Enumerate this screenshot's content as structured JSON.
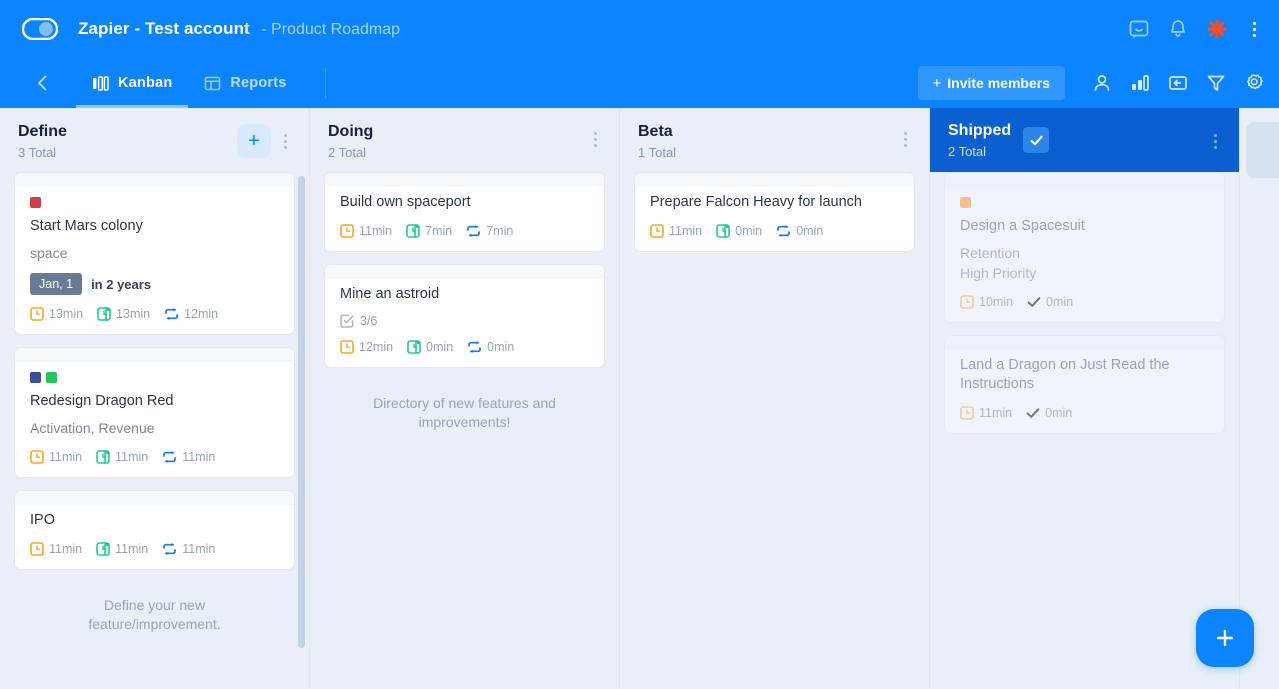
{
  "topbar": {
    "logo_icon": "zapier-toggle-logo",
    "title": "Zapier - Test account",
    "subtitle": "- Product Roadmap",
    "icons": [
      {
        "name": "feedback-icon",
        "label": "Feedback"
      },
      {
        "name": "bell-icon",
        "label": "Notifications"
      },
      {
        "name": "zapier-logo-icon",
        "label": "Zapier"
      },
      {
        "name": "overflow-menu-icon",
        "label": "More"
      }
    ]
  },
  "subbar": {
    "back_icon": "chevron-left-icon",
    "tabs": [
      {
        "label": "Kanban",
        "icon": "kanban-board-icon",
        "active": true
      },
      {
        "label": "Reports",
        "icon": "reports-table-icon",
        "active": false
      }
    ],
    "invite_label": "Invite members",
    "invite_plus": "+",
    "actions": [
      {
        "name": "person-icon",
        "label": "Members"
      },
      {
        "name": "bar-chart-icon",
        "label": "Stats"
      },
      {
        "name": "archive-time-icon",
        "label": "Archive"
      },
      {
        "name": "filter-icon",
        "label": "Filter"
      },
      {
        "name": "gear-icon",
        "label": "Settings"
      }
    ]
  },
  "colors": {
    "brand_blue": "#0b84fe",
    "shipped_header": "#0b5fd0",
    "board_bg": "#eaeef7",
    "label_red": "#c8414b",
    "label_navy": "#3b4d9e",
    "label_green": "#22c55e",
    "label_orange": "#f7b06a",
    "metric_orange": "#f5a623",
    "metric_green": "#20c997",
    "metric_blue": "#1479f5"
  },
  "columns": [
    {
      "name": "Define",
      "count": "3 Total",
      "has_add_button": true,
      "add_label": "+",
      "state": "normal",
      "hint": "Define your new feature/improvement.",
      "has_scrollbar": true,
      "cards": [
        {
          "title": "Start Mars colony",
          "subtitle": "space",
          "labels": [
            "#c8414b"
          ],
          "date_badge": "Jan, 1",
          "date_relative": "in 2 years",
          "metrics": [
            {
              "icon": "clock-orange-icon",
              "value": "13min"
            },
            {
              "icon": "clock-green-icon",
              "value": "13min"
            },
            {
              "icon": "repeat-blue-icon",
              "value": "12min"
            }
          ]
        },
        {
          "title": "Redesign Dragon Red",
          "subtitle": "Activation, Revenue",
          "labels": [
            "#3b4d9e",
            "#22c55e"
          ],
          "metrics": [
            {
              "icon": "clock-orange-icon",
              "value": "11min"
            },
            {
              "icon": "clock-green-icon",
              "value": "11min"
            },
            {
              "icon": "repeat-blue-icon",
              "value": "11min"
            }
          ]
        },
        {
          "title": "IPO",
          "labels": [],
          "metrics": [
            {
              "icon": "clock-orange-icon",
              "value": "11min"
            },
            {
              "icon": "clock-green-icon",
              "value": "11min"
            },
            {
              "icon": "repeat-blue-icon",
              "value": "11min"
            }
          ]
        }
      ]
    },
    {
      "name": "Doing",
      "count": "2 Total",
      "has_add_button": false,
      "state": "normal",
      "hint": "Directory of new features and improvements!",
      "has_scrollbar": false,
      "cards": [
        {
          "title": "Build own spaceport",
          "labels": [],
          "metrics": [
            {
              "icon": "clock-orange-icon",
              "value": "11min"
            },
            {
              "icon": "clock-green-icon",
              "value": "7min"
            },
            {
              "icon": "repeat-blue-icon",
              "value": "7min"
            }
          ]
        },
        {
          "title": "Mine an astroid",
          "labels": [],
          "checklist": "3/6",
          "metrics": [
            {
              "icon": "clock-orange-icon",
              "value": "12min"
            },
            {
              "icon": "clock-green-icon",
              "value": "0min"
            },
            {
              "icon": "repeat-blue-icon",
              "value": "0min"
            }
          ]
        }
      ]
    },
    {
      "name": "Beta",
      "count": "1 Total",
      "has_add_button": false,
      "state": "normal",
      "hint": "",
      "has_scrollbar": false,
      "cards": [
        {
          "title": "Prepare Falcon Heavy for launch",
          "labels": [],
          "metrics": [
            {
              "icon": "clock-orange-icon",
              "value": "11min"
            },
            {
              "icon": "clock-green-icon",
              "value": "0min"
            },
            {
              "icon": "repeat-blue-icon",
              "value": "0min"
            }
          ]
        }
      ]
    },
    {
      "name": "Shipped",
      "count": "2 Total",
      "has_add_button": false,
      "state": "shipped",
      "check_icon": "check-icon",
      "hint": "",
      "has_scrollbar": false,
      "cards": [
        {
          "done": true,
          "title": "Design a Spacesuit",
          "subtitle": "Retention\nHigh Priority",
          "labels": [
            "#f7b06a"
          ],
          "metrics": [
            {
              "icon": "clock-orange-icon",
              "value": "10min"
            },
            {
              "icon": "check-dark-icon",
              "value": "0min"
            }
          ]
        },
        {
          "done": true,
          "title": "Land a Dragon on Just Read the Instructions",
          "labels": [],
          "metrics": [
            {
              "icon": "clock-orange-icon",
              "value": "11min"
            },
            {
              "icon": "check-dark-icon",
              "value": "0min"
            }
          ]
        }
      ]
    }
  ],
  "fab": {
    "icon": "plus-icon",
    "label": "Add card"
  }
}
